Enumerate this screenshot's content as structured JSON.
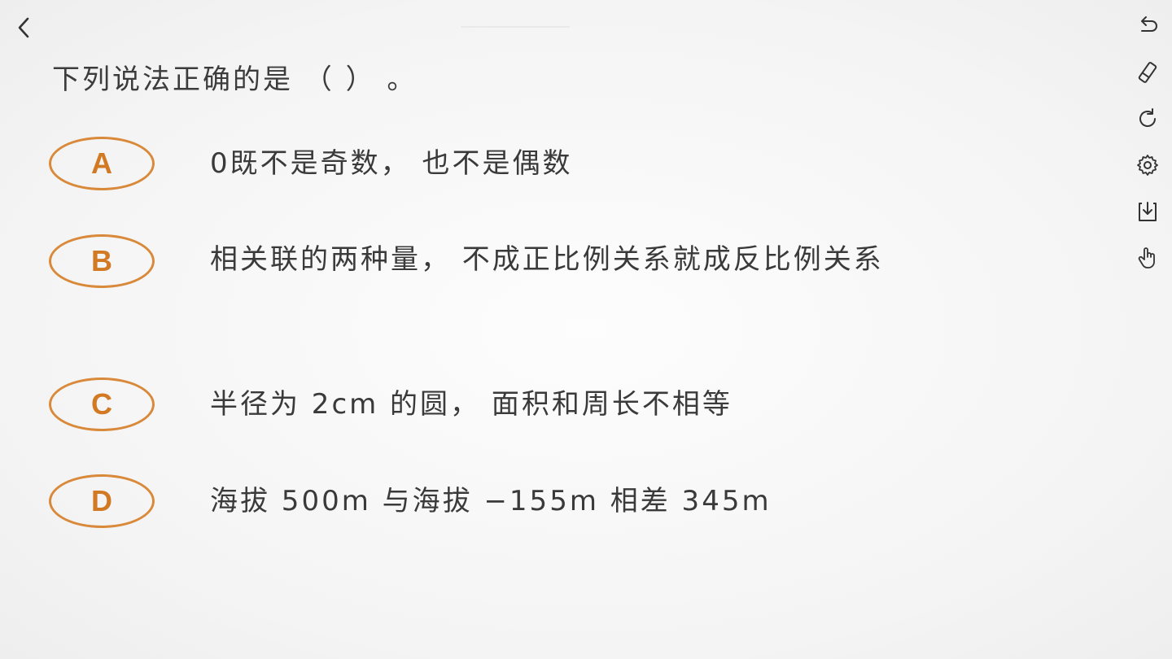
{
  "question": {
    "text": "下列说法正确的是 （   ） 。"
  },
  "options": [
    {
      "letter": "A",
      "text": "0既不是奇数， 也不是偶数"
    },
    {
      "letter": "B",
      "text": "相关联的两种量， 不成正比例关系就成反比例关系"
    },
    {
      "letter": "C",
      "text": "半径为 2cm 的圆， 面积和周长不相等"
    },
    {
      "letter": "D",
      "text": "海拔 500m 与海拔 −155m 相差 345m"
    }
  ],
  "colors": {
    "accent": "#d9893a",
    "text": "#3a3a3a",
    "icon": "#333333"
  },
  "toolbar": {
    "icons": [
      "undo-icon",
      "eraser-icon",
      "refresh-icon",
      "settings-icon",
      "download-icon",
      "hand-pointer-icon"
    ]
  },
  "nav": {
    "back_icon": "chevron-left-icon"
  }
}
